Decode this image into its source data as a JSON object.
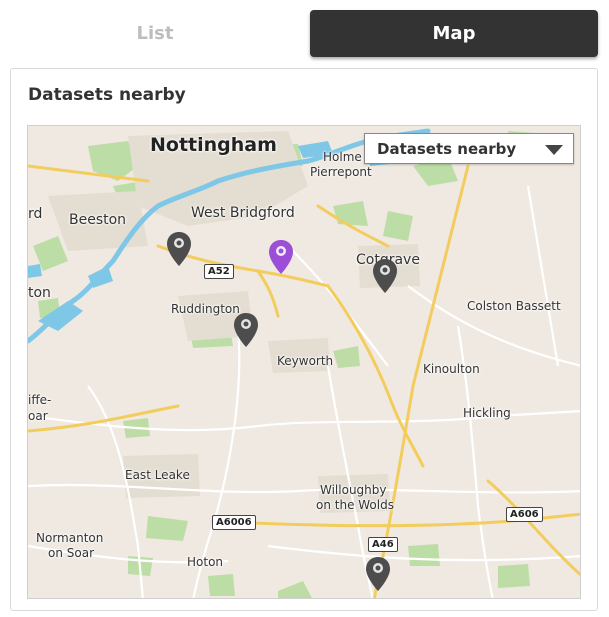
{
  "tabs": {
    "list_label": "List",
    "map_label": "Map",
    "active": "Map"
  },
  "panel": {
    "title": "Datasets nearby"
  },
  "map": {
    "dropdown": {
      "selected": "Datasets nearby"
    },
    "places": {
      "nottingham": "Nottingham",
      "holme_pierrepont_1": "Holme",
      "holme_pierrepont_2": "Pierrepont",
      "beeston": "Beeston",
      "west_bridgford": "West Bridgford",
      "ord": "rd",
      "cotgrave": "Cotgrave",
      "colston_bassett": "Colston Bassett",
      "ton": "ton",
      "ruddington": "Ruddington",
      "keyworth": "Keyworth",
      "kinoulton": "Kinoulton",
      "hickling": "Hickling",
      "iffe_1": "iffe-",
      "iffe_2": "oar",
      "east_leake": "East Leake",
      "willoughby_1": "Willoughby",
      "willoughby_2": "on the Wolds",
      "normanton_1": "Normanton",
      "normanton_2": "on Soar",
      "hoton": "Hoton"
    },
    "roads": {
      "a52": "A52",
      "a6006": "A6006",
      "a606": "A606",
      "a46": "A46"
    },
    "pin_colors": {
      "default": "#4d4d4d",
      "selected": "#9b4fd6"
    }
  }
}
